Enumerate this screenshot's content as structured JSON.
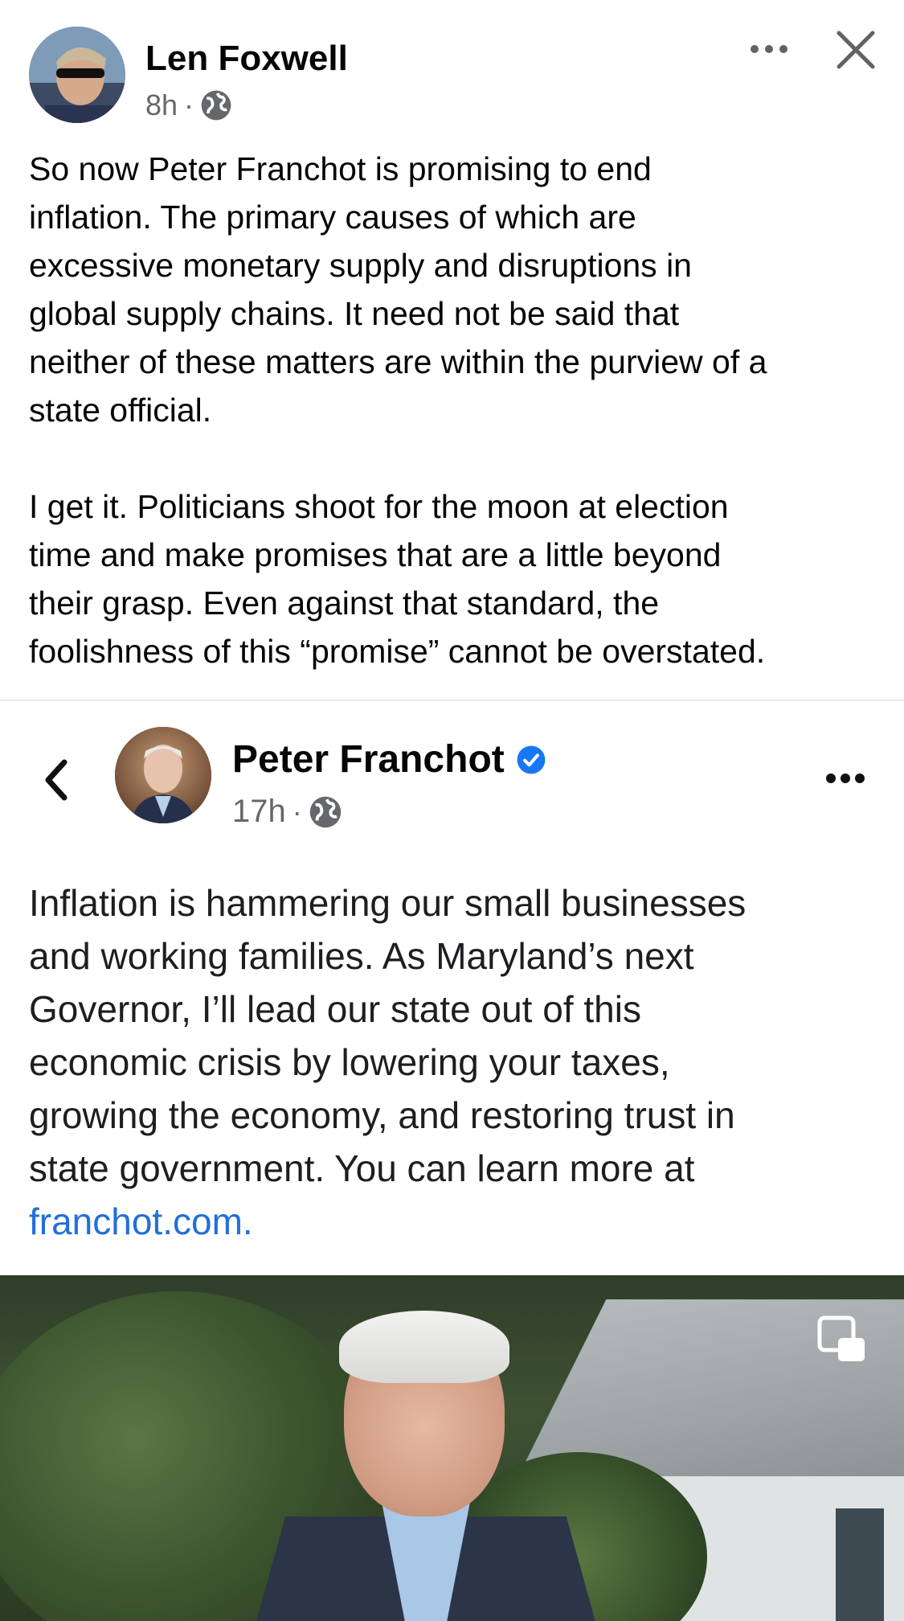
{
  "post": {
    "author": "Len Foxwell",
    "time": "8h",
    "dot": "·",
    "paragraphs": [
      "So now Peter Franchot is promising to end\ninflation. The primary causes of which are\nexcessive monetary supply and disruptions in\nglobal supply chains. It need not be said that\nneither of these matters are within the purview of a\nstate official.",
      "I get it. Politicians shoot for the moon at election\ntime and make promises that are a little beyond\ntheir grasp. Even against that standard, the\nfoolishness of this “promise” cannot be overstated."
    ]
  },
  "shared_post": {
    "author": "Peter Franchot",
    "time": "17h",
    "dot": "·",
    "lines": [
      "Inflation is hammering our small businesses",
      "and working families. As Maryland’s next",
      "Governor, I’ll lead our state out of this",
      "economic crisis by lowering your taxes,",
      "growing the economy, and restoring trust in",
      "state government. You can learn more at"
    ],
    "link": "franchot.com."
  },
  "icons": {
    "globe": "globe-icon",
    "more": "more-options-icon",
    "close": "close-icon",
    "back": "chevron-left-icon",
    "verified": "verified-badge-icon",
    "pip": "picture-in-picture-icon"
  },
  "colors": {
    "link": "#216fdb",
    "verified": "#1877f2",
    "secondary_text": "#65676b",
    "divider": "#e4e6eb"
  }
}
